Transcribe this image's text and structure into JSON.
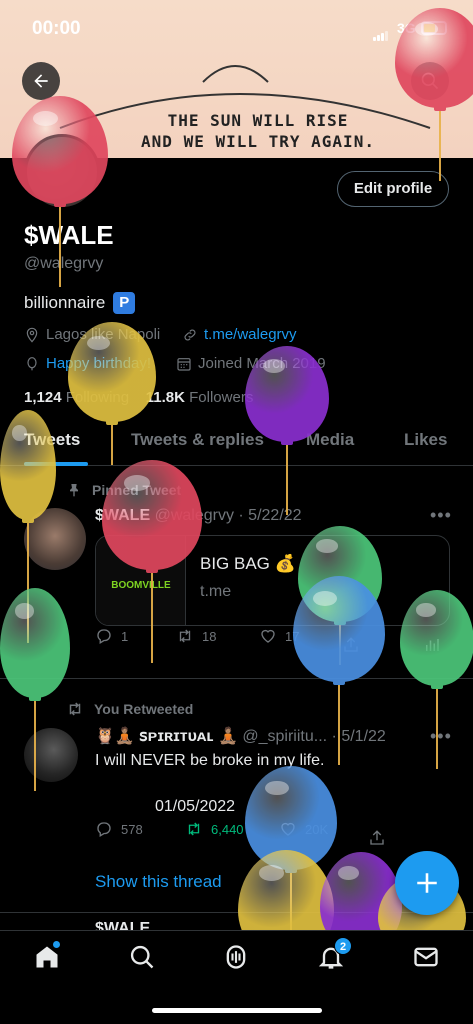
{
  "status_bar": {
    "time": "00:00",
    "network": "3G"
  },
  "banner": {
    "quote_line1": "THE SUN WILL RISE",
    "quote_line2": "AND WE WILL TRY AGAIN."
  },
  "profile": {
    "edit_button": "Edit profile",
    "display_name": "$WALE",
    "handle": "@walegrvy",
    "bio": "billionnaire",
    "bio_badge": "P",
    "location": "Lagos like Napoli",
    "link": "t.me/walegrvy",
    "birthday": "Happy birthday!",
    "joined": "Joined March 2019",
    "following_count": "1,124",
    "following_label": "Following",
    "followers_count": "11.8K",
    "followers_label": "Followers"
  },
  "tabs": [
    {
      "label": "Tweets",
      "active": true
    },
    {
      "label": "Tweets & replies"
    },
    {
      "label": "Media"
    },
    {
      "label": "Likes"
    }
  ],
  "tweets": [
    {
      "context": "Pinned Tweet",
      "author": "$WALE",
      "handle": "@walegrvy",
      "date": "· 5/22/22",
      "card": {
        "thumb_text": "BOOMVILLE",
        "title": "BIG BAG 💰",
        "domain": "t.me"
      },
      "replies": "1",
      "retweets": "18",
      "likes": "17"
    },
    {
      "context": "You Retweeted",
      "author": "🦉🧘🏽 ꜱᴘɪʀɪᴛᴜᴀʟ 🧘🏽",
      "handle": "@_spiriitu...",
      "date": "· 5/1/22",
      "text": "I will NEVER be broke in my life.",
      "date_text": "01/05/2022",
      "replies": "578",
      "retweets": "6,440",
      "likes": "20K",
      "show_thread": "Show this thread"
    },
    {
      "author": "$WALE"
    }
  ],
  "nav": {
    "notifications_badge": "2"
  },
  "colors": {
    "accent": "#1d9bf0",
    "retweet_green": "#00ba7c",
    "background": "#000000"
  },
  "balloons": [
    {
      "color": "#e0475e"
    },
    {
      "color": "#e0475e"
    },
    {
      "color": "#e0c040"
    },
    {
      "color": "#8a2fd0"
    },
    {
      "color": "#e0c040"
    },
    {
      "color": "#e0475e"
    },
    {
      "color": "#4cc77a"
    },
    {
      "color": "#4a90e2"
    },
    {
      "color": "#4cc77a"
    },
    {
      "color": "#4cc77a"
    },
    {
      "color": "#4a90e2"
    },
    {
      "color": "#e0c040"
    },
    {
      "color": "#8a2fd0"
    },
    {
      "color": "#e0c040"
    }
  ]
}
